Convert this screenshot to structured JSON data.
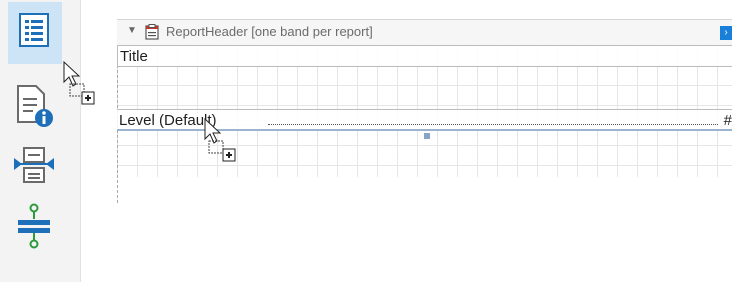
{
  "toolbox": {
    "tools": [
      {
        "name": "detail-band-tool",
        "icon": "detail-list-icon",
        "selected": true
      },
      {
        "name": "report-info-tool",
        "icon": "document-info-icon",
        "selected": false
      },
      {
        "name": "group-header-tool",
        "icon": "group-split-icon",
        "selected": false
      },
      {
        "name": "page-break-tool",
        "icon": "page-break-icon",
        "selected": false
      }
    ]
  },
  "band": {
    "caption": "ReportHeader [one band per report]",
    "caret_glyph": "▼",
    "expand_glyph": "›",
    "title_text": "Title",
    "level_text": "Level (Default)",
    "level_tail": "#"
  },
  "colors": {
    "accent": "#1a7fd8",
    "selection": "#cde4f7",
    "grid": "#e6e6e6"
  }
}
